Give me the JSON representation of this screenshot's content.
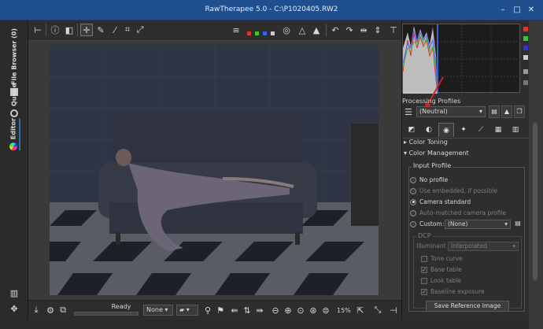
{
  "window": {
    "title": "RawTherapee 5.0 - C:\\P1020405.RW2"
  },
  "left_tabs": [
    {
      "label": "File Browser (0)",
      "icon": "folder-icon"
    },
    {
      "label": "Queue",
      "icon": "gears-icon"
    },
    {
      "label": "Editor",
      "icon": "color-wheel-icon"
    }
  ],
  "status": {
    "ready": "Ready"
  },
  "bottom": {
    "none_combo": "None",
    "zoom": "15%"
  },
  "processing_profiles": {
    "label": "Processing Profiles",
    "selected": "(Neutral)"
  },
  "tools": {
    "color_toning": "Color Toning",
    "color_management": "Color Management",
    "input_profile": {
      "title": "Input Profile",
      "options": [
        {
          "label": "No profile",
          "selected": false,
          "disabled": false
        },
        {
          "label": "Use embedded, if possible",
          "selected": false,
          "disabled": true
        },
        {
          "label": "Camera standard",
          "selected": true,
          "disabled": false
        },
        {
          "label": "Auto-matched camera profile",
          "selected": false,
          "disabled": true
        },
        {
          "label": "Custom:",
          "selected": false,
          "disabled": false
        }
      ],
      "custom_value": "(None)"
    },
    "dcp": {
      "title": "DCP",
      "illuminant_label": "Illuminant",
      "illuminant_value": "Interpolated",
      "checks": [
        {
          "label": "Tone curve",
          "checked": false
        },
        {
          "label": "Base table",
          "checked": true
        },
        {
          "label": "Look table",
          "checked": false
        },
        {
          "label": "Baseline exposure",
          "checked": true
        }
      ]
    },
    "save_reference": "Save Reference Image"
  },
  "colors": {
    "titlebar": "#1f4f8f",
    "accent": "#2f6db0",
    "arrow": "#d42020"
  }
}
